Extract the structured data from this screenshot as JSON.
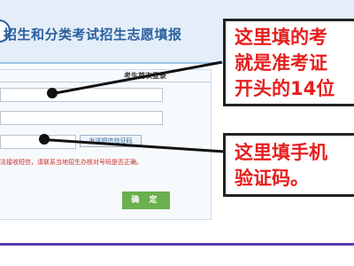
{
  "header": {
    "title": "招生和分类考试招生志愿填报"
  },
  "form": {
    "title": "考生首次登录",
    "exam_number_value": "",
    "id_number_value": "",
    "sms_code_value": "",
    "sms_button_label": "发送短信验证码",
    "notice": "法接收短信，请联系当地招生办核对号码是否正确。",
    "confirm_label": "确 定"
  },
  "callouts": [
    {
      "lines": [
        "这里填的考",
        "就是准考证",
        "开头的14位"
      ]
    },
    {
      "lines": [
        "这里填手机",
        "验证码。"
      ]
    }
  ],
  "colors": {
    "header_blue": "#2b5f9e",
    "callout_red": "#e61e1e",
    "notice_red": "#cc2a2a",
    "confirm_green": "#6ab04c"
  }
}
